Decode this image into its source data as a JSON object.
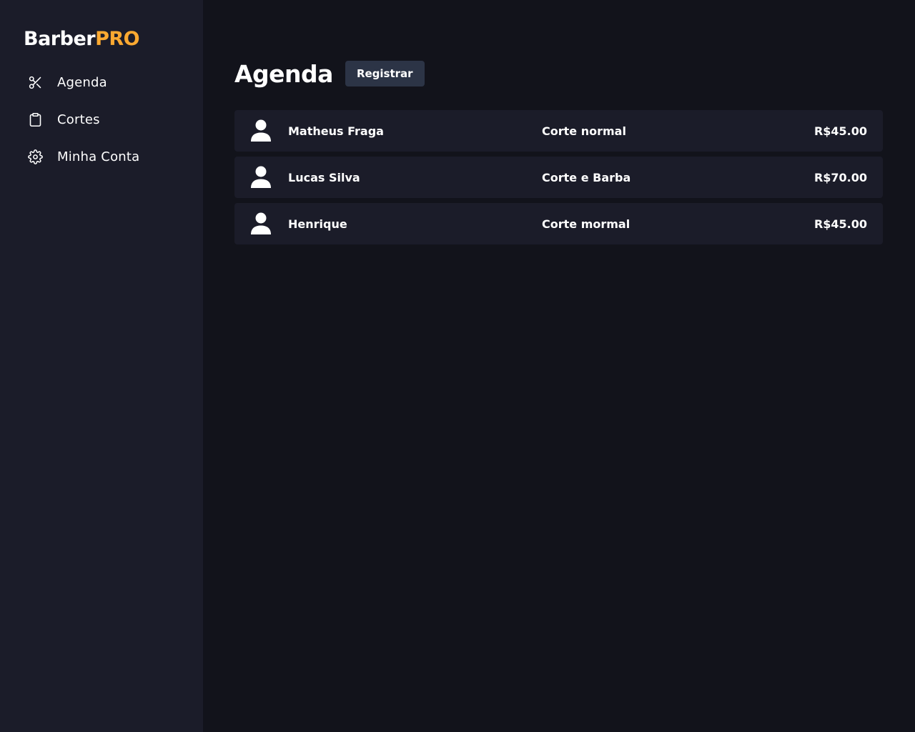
{
  "brand": {
    "part1": "Barber",
    "part2": "PRO",
    "accent_color": "#fba931"
  },
  "sidebar": {
    "items": [
      {
        "label": "Agenda",
        "icon": "scissors-icon"
      },
      {
        "label": "Cortes",
        "icon": "clipboard-icon"
      },
      {
        "label": "Minha Conta",
        "icon": "gear-icon"
      }
    ]
  },
  "main": {
    "title": "Agenda",
    "register_label": "Registrar",
    "appointments": [
      {
        "name": "Matheus Fraga",
        "service": "Corte normal",
        "price": "R$45.00"
      },
      {
        "name": "Lucas Silva",
        "service": "Corte e Barba",
        "price": "R$70.00"
      },
      {
        "name": "Henrique",
        "service": "Corte mormal",
        "price": "R$45.00"
      }
    ]
  }
}
